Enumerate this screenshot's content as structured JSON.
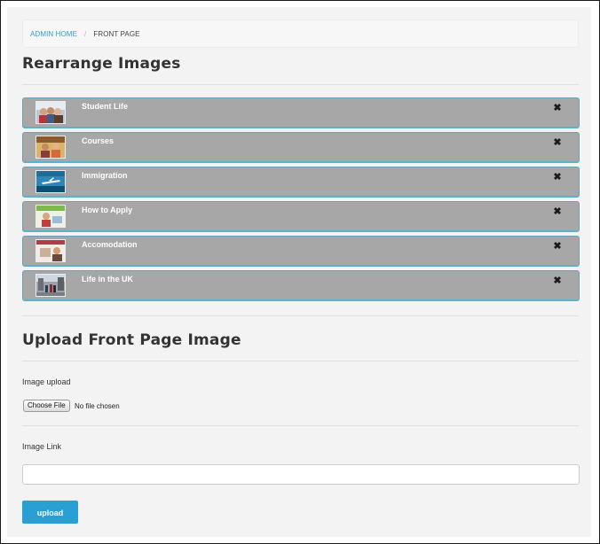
{
  "breadcrumb": {
    "home": "ADMIN HOME",
    "separator": "/",
    "current": "FRONT PAGE"
  },
  "rearrange": {
    "title": "Rearrange Images",
    "items": [
      {
        "label": "Student Life",
        "thumb_icon": "student-life-photo-icon",
        "remove_icon": "close-icon"
      },
      {
        "label": "Courses",
        "thumb_icon": "courses-photo-icon",
        "remove_icon": "close-icon"
      },
      {
        "label": "Immigration",
        "thumb_icon": "immigration-photo-icon",
        "remove_icon": "close-icon"
      },
      {
        "label": "How to Apply",
        "thumb_icon": "how-to-apply-photo-icon",
        "remove_icon": "close-icon"
      },
      {
        "label": "Accomodation",
        "thumb_icon": "accomodation-photo-icon",
        "remove_icon": "close-icon"
      },
      {
        "label": "Life in the UK",
        "thumb_icon": "life-in-the-uk-photo-icon",
        "remove_icon": "close-icon"
      }
    ],
    "remove_glyph": "✖"
  },
  "upload": {
    "title": "Upload Front Page Image",
    "image_label": "Image upload",
    "choose_file": "Choose File",
    "file_status": "No file chosen",
    "link_label": "Image Link",
    "link_value": "",
    "submit": "upload"
  },
  "colors": {
    "accent": "#2a9fd6",
    "item_bg": "#a7a7a7",
    "item_border": "#5cb2cd",
    "panel_bg": "#f3f3f3"
  }
}
